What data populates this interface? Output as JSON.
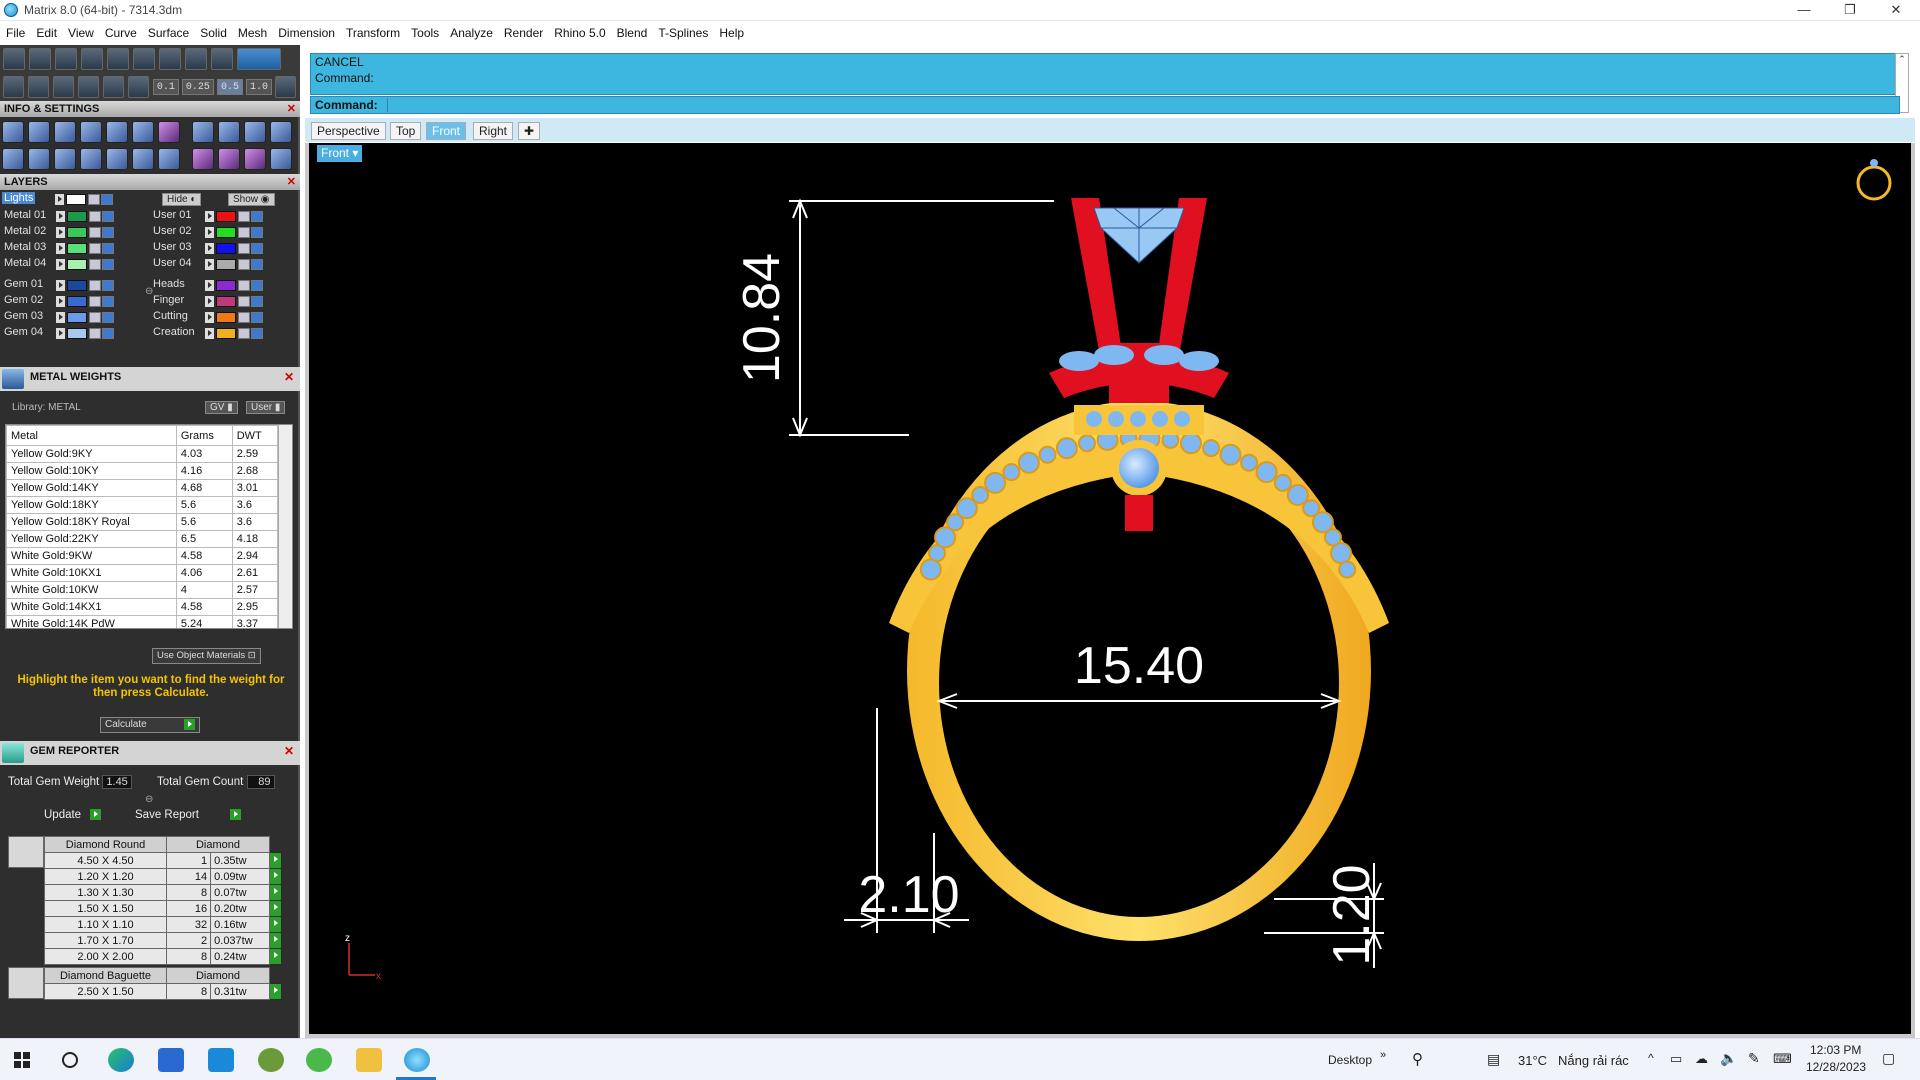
{
  "titlebar": {
    "title": "Matrix 8.0 (64-bit) - 7314.3dm",
    "minimize": "—",
    "restore": "❐",
    "close": "✕"
  },
  "menu": [
    "File",
    "Edit",
    "View",
    "Curve",
    "Surface",
    "Solid",
    "Mesh",
    "Dimension",
    "Transform",
    "Tools",
    "Analyze",
    "Render",
    "Rhino 5.0",
    "Blend",
    "T-Splines",
    "Help"
  ],
  "toolbar": {
    "snap_values": [
      "0.1",
      "0.25",
      "0.5",
      "1.0"
    ]
  },
  "info_settings": {
    "title": "INFO & SETTINGS"
  },
  "layers": {
    "title": "LAYERS",
    "lights_label": "Lights",
    "hide_label": "Hide",
    "show_label": "Show",
    "left": [
      {
        "name": "Metal 01",
        "color": "#1a9a4a"
      },
      {
        "name": "Metal 02",
        "color": "#3ac85a"
      },
      {
        "name": "Metal 03",
        "color": "#5ae07a"
      },
      {
        "name": "Metal 04",
        "color": "#a8f0b0"
      },
      {
        "name": "Gem 01",
        "color": "#1a4aa0"
      },
      {
        "name": "Gem 02",
        "color": "#3a6ad0"
      },
      {
        "name": "Gem 03",
        "color": "#6a9ae8"
      },
      {
        "name": "Gem 04",
        "color": "#a8c8f0"
      }
    ],
    "right": [
      {
        "name": "User 01",
        "color": "#ee1111"
      },
      {
        "name": "User 02",
        "color": "#22dd22"
      },
      {
        "name": "User 03",
        "color": "#1111ee"
      },
      {
        "name": "User 04",
        "color": "#aaaaaa"
      },
      {
        "name": "Heads",
        "color": "#8a2ad0"
      },
      {
        "name": "Finger",
        "color": "#c03a7a"
      },
      {
        "name": "Cutting",
        "color": "#ee7a11"
      },
      {
        "name": "Creation",
        "color": "#f0b020"
      }
    ]
  },
  "metal_weights": {
    "title": "METAL WEIGHTS",
    "library": "Library: METAL",
    "gv_label": "GV",
    "user_label": "User",
    "columns": [
      "Metal",
      "Grams",
      "DWT"
    ],
    "rows": [
      [
        "Yellow Gold:9KY",
        "4.03",
        "2.59"
      ],
      [
        "Yellow Gold:10KY",
        "4.16",
        "2.68"
      ],
      [
        "Yellow Gold:14KY",
        "4.68",
        "3.01"
      ],
      [
        "Yellow Gold:18KY",
        "5.6",
        "3.6"
      ],
      [
        "Yellow Gold:18KY Royal",
        "5.6",
        "3.6"
      ],
      [
        "Yellow Gold:22KY",
        "6.5",
        "4.18"
      ],
      [
        "White Gold:9KW",
        "4.58",
        "2.94"
      ],
      [
        "White Gold:10KX1",
        "4.06",
        "2.61"
      ],
      [
        "White Gold:10KW",
        "4",
        "2.57"
      ],
      [
        "White Gold:14KX1",
        "4.58",
        "2.95"
      ],
      [
        "White Gold:14K PdW",
        "5.24",
        "3.37"
      ]
    ],
    "use_object_materials": "Use Object Materials",
    "hint": "Highlight the item you want to find the weight for then press Calculate.",
    "calculate": "Calculate"
  },
  "gem_reporter": {
    "title": "GEM REPORTER",
    "total_weight_label": "Total Gem Weight",
    "total_weight": "1.45",
    "total_count_label": "Total Gem Count",
    "total_count": "89",
    "update": "Update",
    "save_report": "Save Report",
    "groups": [
      {
        "shape": "Diamond Round",
        "material": "Diamond",
        "rows": [
          [
            "4.50 X 4.50",
            "1",
            "0.35tw"
          ],
          [
            "1.20 X 1.20",
            "14",
            "0.09tw"
          ],
          [
            "1.30 X 1.30",
            "8",
            "0.07tw"
          ],
          [
            "1.50 X 1.50",
            "16",
            "0.20tw"
          ],
          [
            "1.10 X 1.10",
            "32",
            "0.16tw"
          ],
          [
            "1.70 X 1.70",
            "2",
            "0.037tw"
          ],
          [
            "2.00 X 2.00",
            "8",
            "0.24tw"
          ]
        ]
      },
      {
        "shape": "Diamond Baguette",
        "material": "Diamond",
        "rows": [
          [
            "2.50 X 1.50",
            "8",
            "0.31tw"
          ]
        ]
      }
    ]
  },
  "command": {
    "history_1": "CANCEL",
    "history_2": "Command:",
    "prompt": "Command:"
  },
  "view_tabs": [
    "Perspective",
    "Top",
    "Front",
    "Right"
  ],
  "active_view": "Front",
  "viewport": {
    "label": "Front",
    "dimensions": {
      "height": "10.84",
      "inner_diameter": "15.40",
      "left_thickness": "2.10",
      "right_thickness": "1.20"
    },
    "axis": {
      "z": "z",
      "x": "x"
    }
  },
  "taskbar": {
    "desktop": "Desktop",
    "weather_temp": "31°C",
    "weather_text": "Nắng rải rác",
    "time": "12:03 PM",
    "date": "12/28/2023"
  },
  "colors": {
    "accent": "#3db7e0",
    "gold": "#f5b82a",
    "prong": "#e01020",
    "gem": "#7fb8f0"
  }
}
